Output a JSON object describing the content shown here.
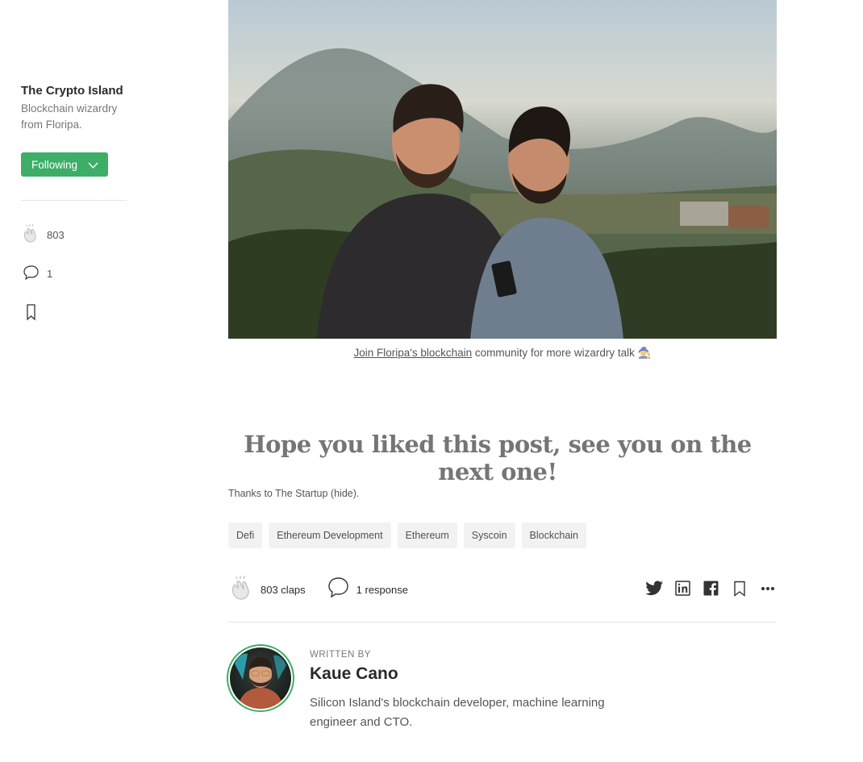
{
  "sidebar": {
    "publication_name": "The Crypto Island",
    "publication_description": "Blockchain wizardry from Floripa.",
    "follow_label": "Following",
    "claps_count": "803",
    "responses_count": "1"
  },
  "article": {
    "caption_link": "Join Floripa's blockchain",
    "caption_rest": " community for more wizardry talk ",
    "caption_emoji": "🧙",
    "headline": "Hope you liked this post, see you on the next one!",
    "thanks": "Thanks to The Startup (hide).",
    "tags": [
      "Defi",
      "Ethereum Development",
      "Ethereum",
      "Syscoin",
      "Blockchain"
    ]
  },
  "actions": {
    "claps": "803 claps",
    "responses": "1 response"
  },
  "author": {
    "written_by": "WRITTEN BY",
    "name": "Kaue Cano",
    "bio": "Silicon Island's blockchain developer, machine learning engineer and CTO."
  },
  "colors": {
    "accent": "#3cae67",
    "tag_bg": "#f2f2f2",
    "divider": "#e6e6e6"
  }
}
